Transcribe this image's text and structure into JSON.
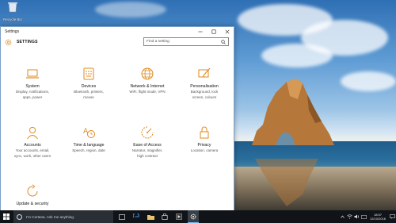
{
  "desktop": {
    "recycle_bin_label": "Recycle Bin"
  },
  "window": {
    "title": "Settings",
    "header_title": "SETTINGS",
    "search_placeholder": "Find a setting",
    "accent_color": "#e08a1e"
  },
  "tiles": [
    {
      "name": "System",
      "desc1": "Display, notifications,",
      "desc2": "apps, power",
      "desc3": "",
      "icon": "laptop-icon"
    },
    {
      "name": "Devices",
      "desc1": "Bluetooth, printers,",
      "desc2": "mouse",
      "desc3": "",
      "icon": "keyboard-icon"
    },
    {
      "name": "Network & Internet",
      "desc1": "WiFi, flight mode, VPN",
      "desc2": "",
      "desc3": "",
      "icon": "globe-icon"
    },
    {
      "name": "Personalisation",
      "desc1": "Background, lock",
      "desc2": "screen, colours",
      "desc3": "",
      "icon": "paintbrush-icon"
    },
    {
      "name": "Accounts",
      "desc1": "Your accounts, email,",
      "desc2": "sync, work, other users",
      "desc3": "",
      "icon": "person-icon"
    },
    {
      "name": "Time & language",
      "desc1": "Speech, region, date",
      "desc2": "",
      "desc3": "",
      "icon": "clock-language-icon"
    },
    {
      "name": "Ease of Access",
      "desc1": "Narrator, magnifier,",
      "desc2": "high contrast",
      "desc3": "",
      "icon": "ease-of-access-icon"
    },
    {
      "name": "Privacy",
      "desc1": "Location, camera",
      "desc2": "",
      "desc3": "",
      "icon": "lock-icon"
    },
    {
      "name": "Update & security",
      "desc1": "",
      "desc2": "",
      "desc3": "",
      "icon": "refresh-icon"
    }
  ],
  "taskbar": {
    "cortana_text": "I'm Cortana. Ask me anything.",
    "time": "18:57",
    "date": "12/10/2016"
  }
}
